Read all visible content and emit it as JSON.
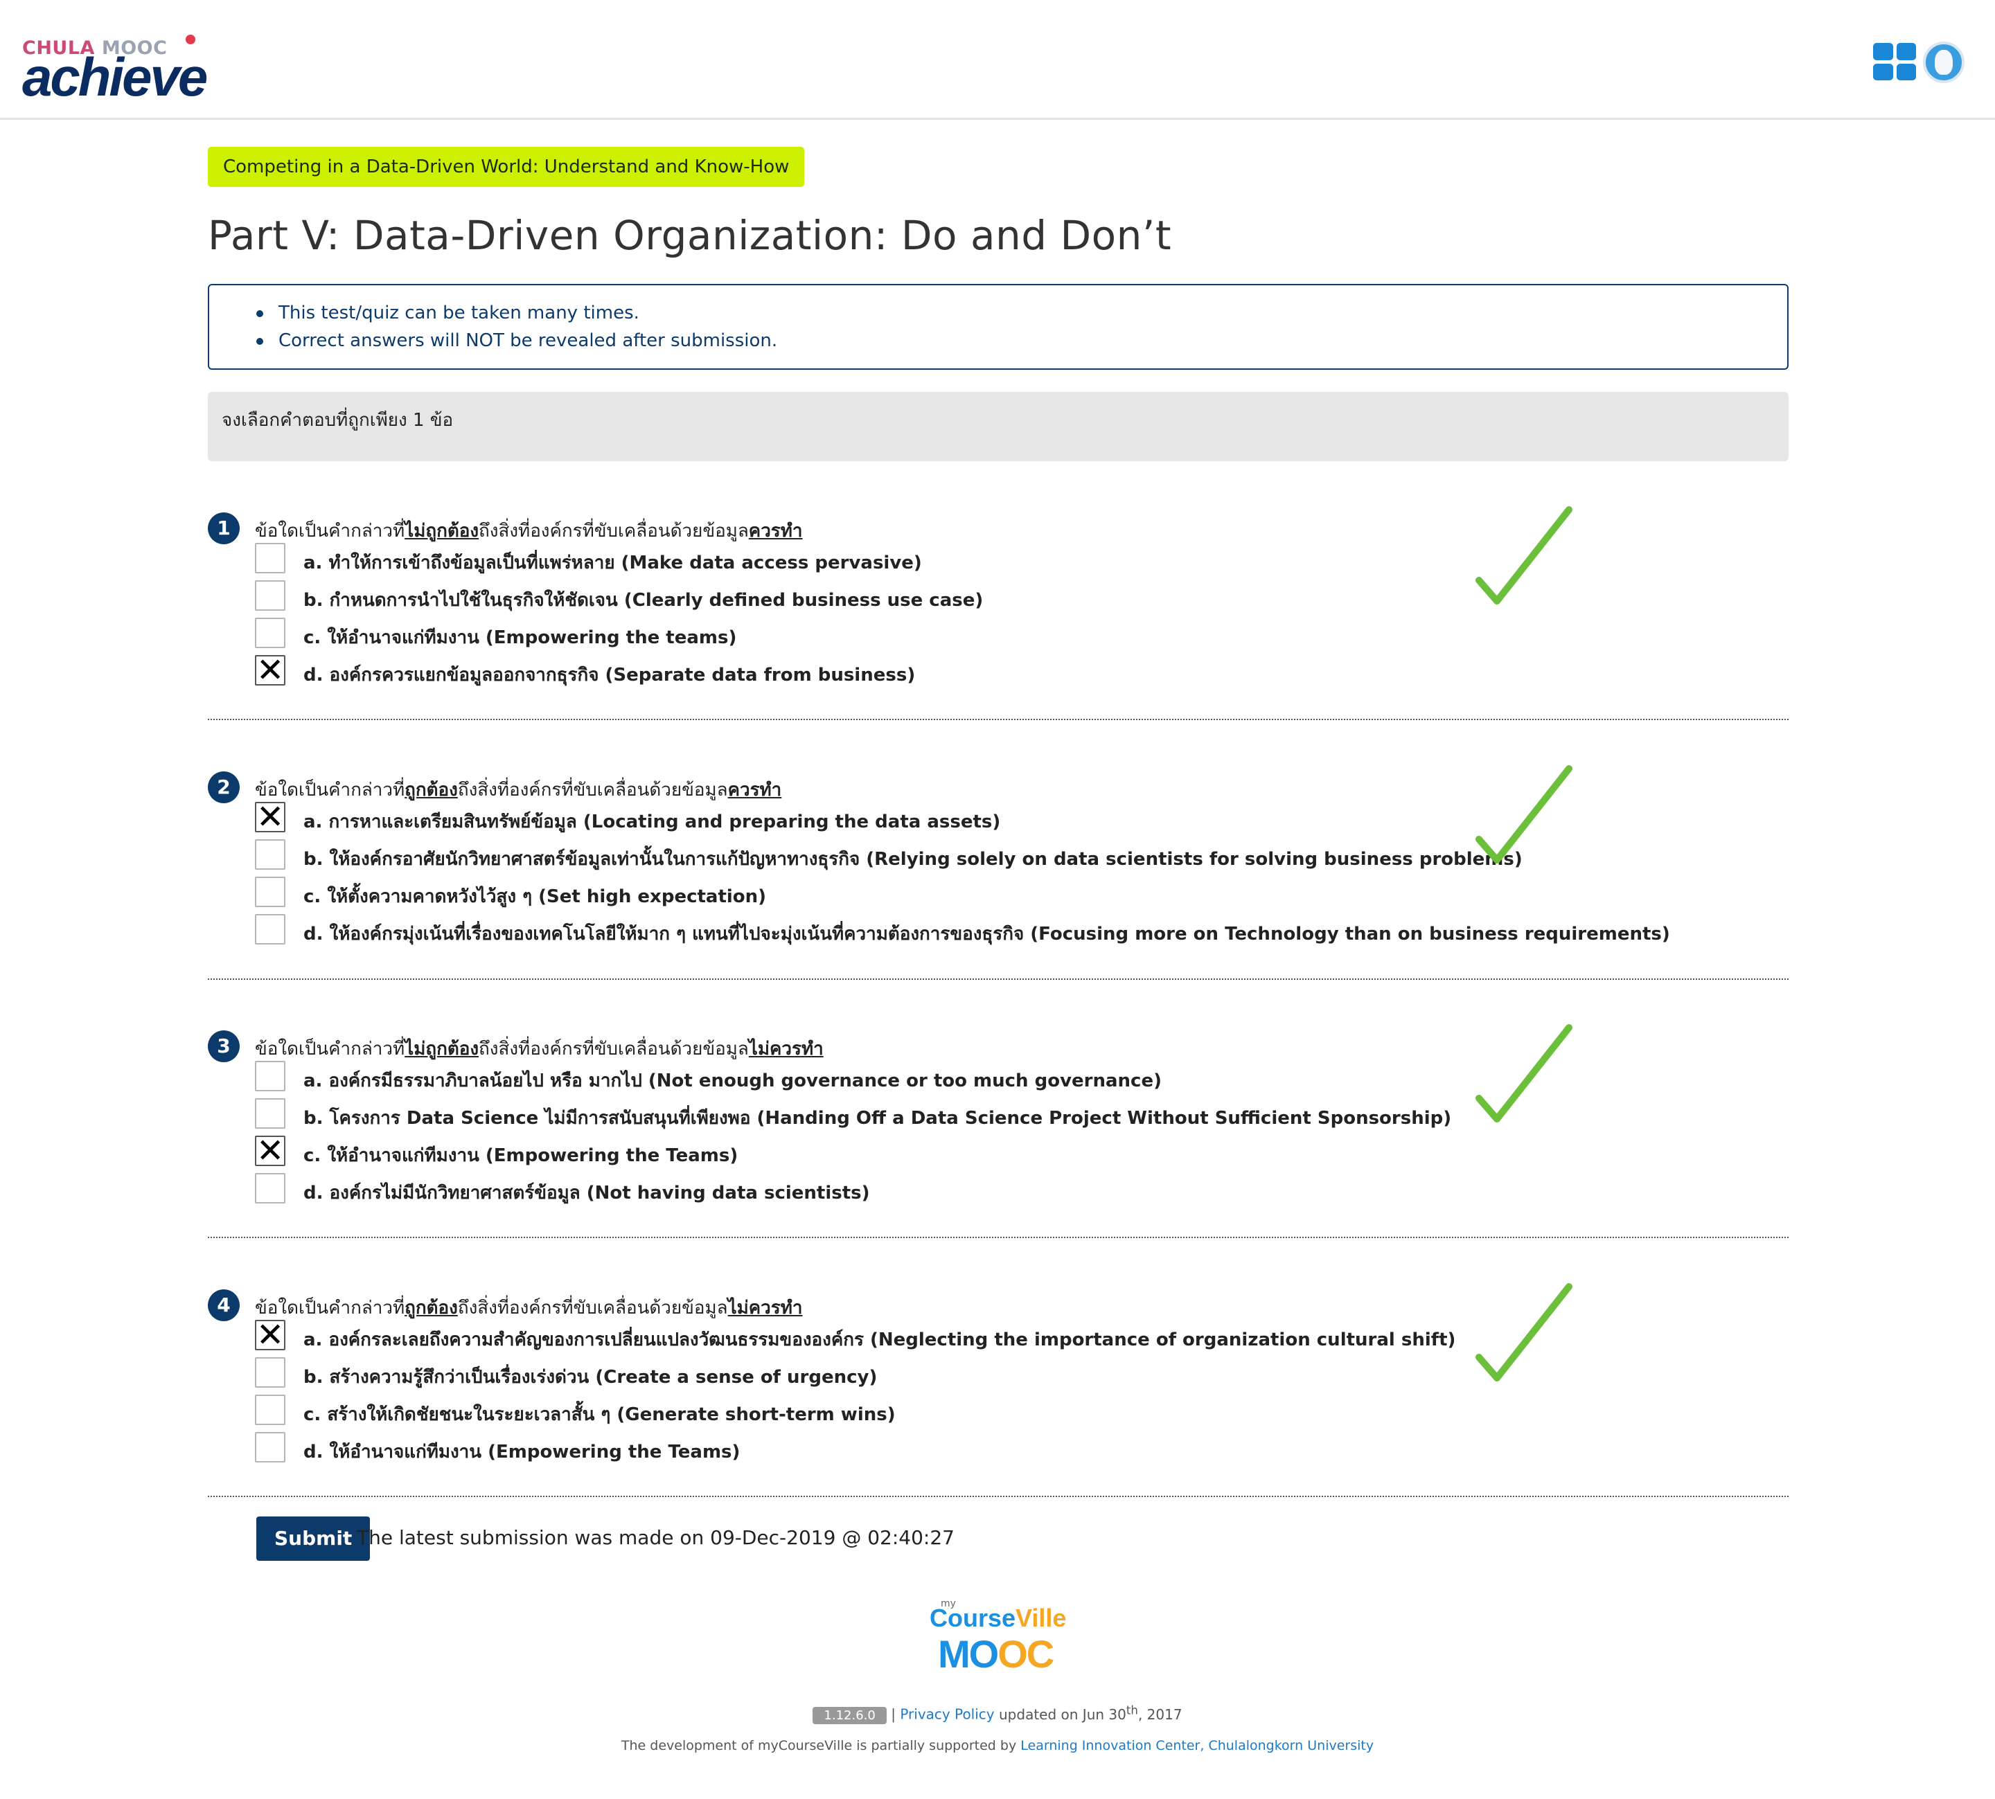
{
  "header": {
    "logo_top_chula": "CHULA",
    "logo_top_mooc": "MOOC",
    "logo_main": "achieve",
    "apps_icon": "grid-apps-icon",
    "avatar_icon": "user-avatar"
  },
  "course_tag": "Competing in a Data-Driven World: Understand and Know-How",
  "page_title": "Part V: Data-Driven Organization: Do and Don’t",
  "notice": [
    "This test/quiz can be taken many times.",
    "Correct answers will NOT be revealed after submission."
  ],
  "instruction": "จงเลือกคำตอบที่ถูกเพียง 1 ข้อ",
  "questions": [
    {
      "number": "1",
      "prefix": "ข้อใดเป็นคำกล่าวที่",
      "emph1": "ไม่ถูกต้อง",
      "middle": "ถึงสิ่งที่องค์กรที่ขับเคลื่อนด้วยข้อมูล",
      "emph2": "ควรทำ",
      "choices": [
        {
          "label": "a. ทำให้การเข้าถึงข้อมูลเป็นที่แพร่หลาย (Make data access pervasive)",
          "checked": false
        },
        {
          "label": "b. กำหนดการนำไปใช้ในธุรกิจให้ชัดเจน (Clearly defined business use case)",
          "checked": false
        },
        {
          "label": "c. ให้อำนาจแก่ทีมงาน (Empowering the teams)",
          "checked": false
        },
        {
          "label": "d. องค์กรควรแยกข้อมูลออกจากธุรกิจ (Separate data from business)",
          "checked": true
        }
      ],
      "result": "correct-checkmark"
    },
    {
      "number": "2",
      "prefix": "ข้อใดเป็นคำกล่าวที่",
      "emph1": "ถูกต้อง",
      "middle": "ถึงสิ่งที่องค์กรที่ขับเคลื่อนด้วยข้อมูล",
      "emph2": "ควรทำ",
      "choices": [
        {
          "label": "a. การหาและเตรียมสินทรัพย์ข้อมูล (Locating and preparing the data assets)",
          "checked": true
        },
        {
          "label": "b. ให้องค์กรอาศัยนักวิทยาศาสตร์ข้อมูลเท่านั้นในการแก้ปัญหาทางธุรกิจ (Relying solely on data scientists for solving business problems)",
          "checked": false
        },
        {
          "label": "c. ให้ตั้งความคาดหวังไว้สูง ๆ (Set high expectation)",
          "checked": false
        },
        {
          "label": "d. ให้องค์กรมุ่งเน้นที่เรื่องของเทคโนโลยีให้มาก ๆ แทนที่ไปจะมุ่งเน้นที่ความต้องการของธุรกิจ (Focusing more on Technology than on business requirements)",
          "checked": false
        }
      ],
      "result": "correct-checkmark"
    },
    {
      "number": "3",
      "prefix": "ข้อใดเป็นคำกล่าวที่",
      "emph1": "ไม่ถูกต้อง",
      "middle": "ถึงสิ่งที่องค์กรที่ขับเคลื่อนด้วยข้อมูล",
      "emph2": "ไม่ควรทำ",
      "choices": [
        {
          "label": "a. องค์กรมีธรรมาภิบาลน้อยไป หรือ มากไป (Not enough governance or too much governance)",
          "checked": false
        },
        {
          "label": "b. โครงการ Data Science ไม่มีการสนับสนุนที่เพียงพอ (Handing Off a Data Science Project Without Sufficient Sponsorship)",
          "checked": false
        },
        {
          "label": "c. ให้อำนาจแก่ทีมงาน (Empowering the Teams)",
          "checked": true
        },
        {
          "label": "d. องค์กรไม่มีนักวิทยาศาสตร์ข้อมูล (Not having data scientists)",
          "checked": false
        }
      ],
      "result": "correct-checkmark"
    },
    {
      "number": "4",
      "prefix": "ข้อใดเป็นคำกล่าวที่",
      "emph1": "ถูกต้อง",
      "middle": "ถึงสิ่งที่องค์กรที่ขับเคลื่อนด้วยข้อมูล",
      "emph2": "ไม่ควรทำ",
      "choices": [
        {
          "label": "a. องค์กรละเลยถึงความสำคัญของการเปลี่ยนแปลงวัฒนธรรมขององค์กร (Neglecting the importance of organization cultural shift)",
          "checked": true
        },
        {
          "label": "b. สร้างความรู้สึกว่าเป็นเรื่องเร่งด่วน (Create a sense of urgency)",
          "checked": false
        },
        {
          "label": "c. สร้างให้เกิดชัยชนะในระยะเวลาสั้น ๆ (Generate short-term wins)",
          "checked": false
        },
        {
          "label": "d. ให้อำนาจแก่ทีมงาน (Empowering the Teams)",
          "checked": false
        }
      ],
      "result": "correct-checkmark"
    }
  ],
  "submit": {
    "label": "Submit",
    "status": "The latest submission was made on 09-Dec-2019 @ 02:40:27"
  },
  "footer": {
    "logo_my": "my",
    "logo_course": "Course",
    "logo_ville": "Ville",
    "logo_mooc_m": "M",
    "logo_mooc_o1": "O",
    "logo_mooc_o2": "O",
    "logo_mooc_c": "C",
    "version": "1.12.6.0",
    "separator": "|",
    "privacy_link": "Privacy Policy",
    "updated_text": "updated on Jun 30",
    "updated_sup": "th",
    "updated_year": ", 2017",
    "support_text": "The development of myCourseVille is partially supported by",
    "support_link": "Learning Innovation Center, Chulalongkorn University"
  },
  "colors": {
    "accent": "#0b3a6b",
    "tag": "#ccf000",
    "check": "#6cbf3a",
    "link": "#1d7ac7"
  }
}
